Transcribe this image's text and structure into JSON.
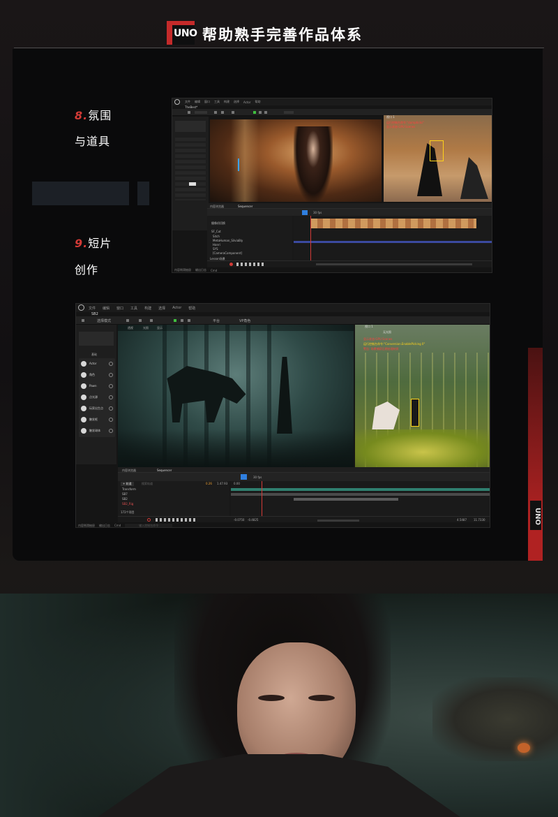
{
  "header": {
    "logo_text": "UNO",
    "title": "帮助熟手完善作品体系",
    "accent_color": "#c42a2a"
  },
  "sections": [
    {
      "num": "8.",
      "line1": "氛围",
      "line2": "与道具"
    },
    {
      "num": "9.",
      "line1": "短片",
      "line2": "创作"
    }
  ],
  "side_logo": "UNO",
  "editor_top": {
    "menu": [
      "文件",
      "编辑",
      "窗口",
      "工具",
      "构建",
      "选择",
      "Actor",
      "帮助"
    ],
    "tab": "TheBest*",
    "viewport_title": "视口 1",
    "red_lines": [
      "运行控制台命令:\"dumpticks\"",
      "显示状态:GPU Scenes"
    ],
    "seq_tab": "Sequencer",
    "outliner_tab": "内容浏览器",
    "seq_fps": "30 fps",
    "tracks": [
      "摄像机切换",
      "SF_Cut",
      "Sitch",
      "MetaHuman_SilviaBly",
      "Hanri",
      "SYS",
      "[CameraComponent]"
    ],
    "status": [
      "内容侧滑抽屉",
      "输出日志",
      "Cmd"
    ],
    "track_count": "Lesson场景"
  },
  "editor_bottom": {
    "menu": [
      "文件",
      "编辑",
      "窗口",
      "工具",
      "构建",
      "选择",
      "Actor",
      "帮助"
    ],
    "tab": "SB2",
    "mode": "选择模式",
    "platform": "平台",
    "vp_label": "VP角色",
    "viewport_tabs": [
      "透视",
      "光照",
      "显示"
    ],
    "viewport_title": "视口 1",
    "unlit": "无光照",
    "red_lines": [
      "显示状态:GPU Scenes",
      "运行控制台命令:\"Conversion.EnablePicking 0\"",
      "警告: 场景捕获后期处理材质"
    ],
    "place_header": "基础",
    "place_items": [
      "Actor",
      "角色",
      "Pawn",
      "点光源",
      "玩家出生点",
      "触发框",
      "触发球体"
    ],
    "seq_tabs": [
      "内容浏览器",
      "Sequencer"
    ],
    "seq_fps": "30 fps",
    "add_track": "+ 轨道",
    "search_placeholder": "搜索轨道",
    "time_start": "0.00",
    "time_cur": "0.26",
    "time_end": "1.47.93",
    "tracks": [
      "Transform",
      "SB7",
      "SB2",
      "SB2_Rig"
    ],
    "track_count": "172个项目",
    "timecodes": [
      "-0.0750",
      "-0.4825",
      "4.5487",
      "11.7330"
    ],
    "status": [
      "内容侧滑抽屉",
      "输出日志",
      "Cmd"
    ],
    "console_placeholder": "输入控制台命令"
  }
}
